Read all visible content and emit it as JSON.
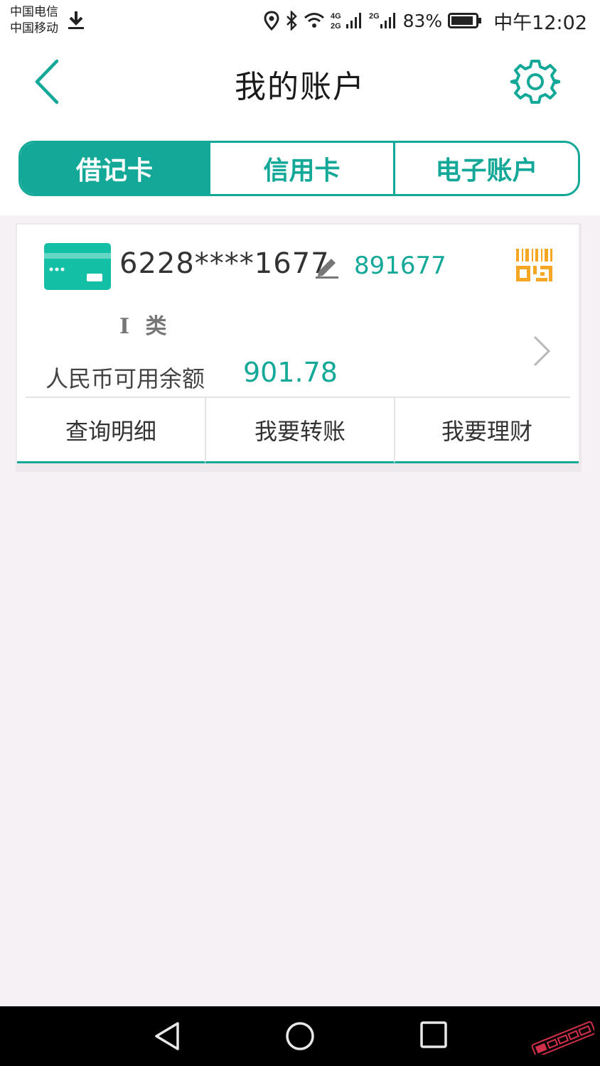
{
  "status_bar": {
    "carrier_1": "中国电信",
    "carrier_2": "中国移动",
    "network_1": "4G",
    "network_2": "2G",
    "network_3": "2G",
    "battery": "83%",
    "time": "中午12:02"
  },
  "header": {
    "title": "我的账户",
    "back_icon": "chevron-left-icon",
    "settings_icon": "gear-icon"
  },
  "tabs": [
    {
      "label": "借记卡",
      "active": true
    },
    {
      "label": "信用卡",
      "active": false
    },
    {
      "label": "电子账户",
      "active": false
    }
  ],
  "card": {
    "number": "6228****1677",
    "alias": "891677",
    "type": "I 类",
    "balance_label": "人民币可用余额",
    "balance": "901.78",
    "actions": [
      "查询明细",
      "我要转账",
      "我要理财"
    ]
  },
  "colors": {
    "accent": "#14a898",
    "qr_orange": "#f5a623",
    "background": "#f6f1f4"
  }
}
